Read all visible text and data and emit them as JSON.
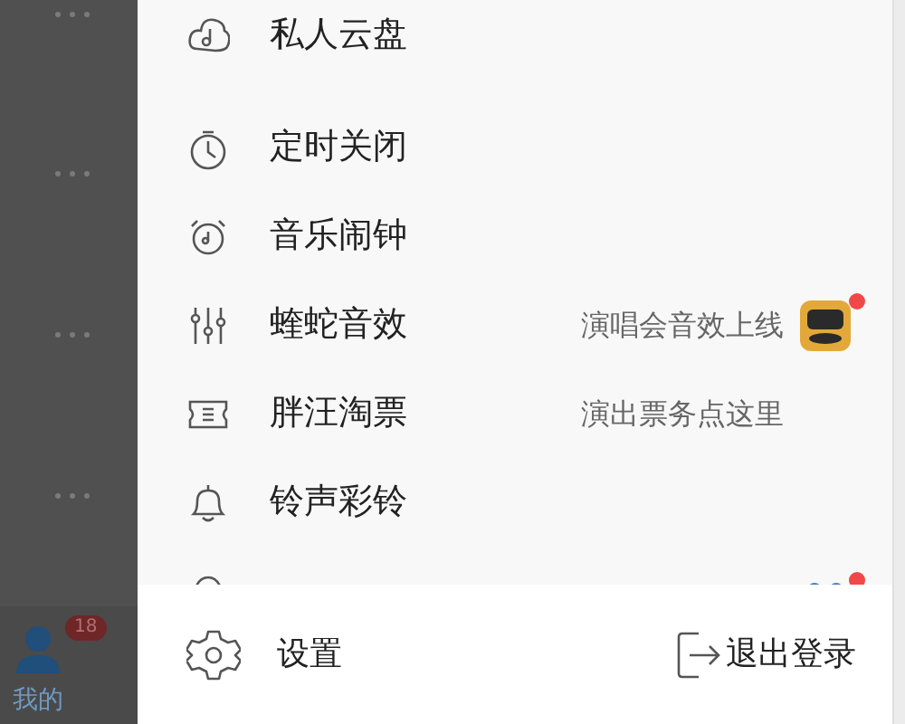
{
  "background": {
    "tab_label": "我的",
    "tab_badge": "18"
  },
  "menu_groups": [
    [
      {
        "label": "私人云盘"
      }
    ],
    [
      {
        "label": "定时关闭"
      },
      {
        "label": "音乐闹钟"
      },
      {
        "label": "蝰蛇音效",
        "hint": "演唱会音效上线",
        "dot": true
      },
      {
        "label": "胖汪淘票",
        "hint": "演出票务点这里",
        "dot": false
      },
      {
        "label": "铃声彩铃"
      },
      {
        "dot": true
      }
    ]
  ],
  "footer": {
    "settings": "设置",
    "logout": "退出登录"
  }
}
